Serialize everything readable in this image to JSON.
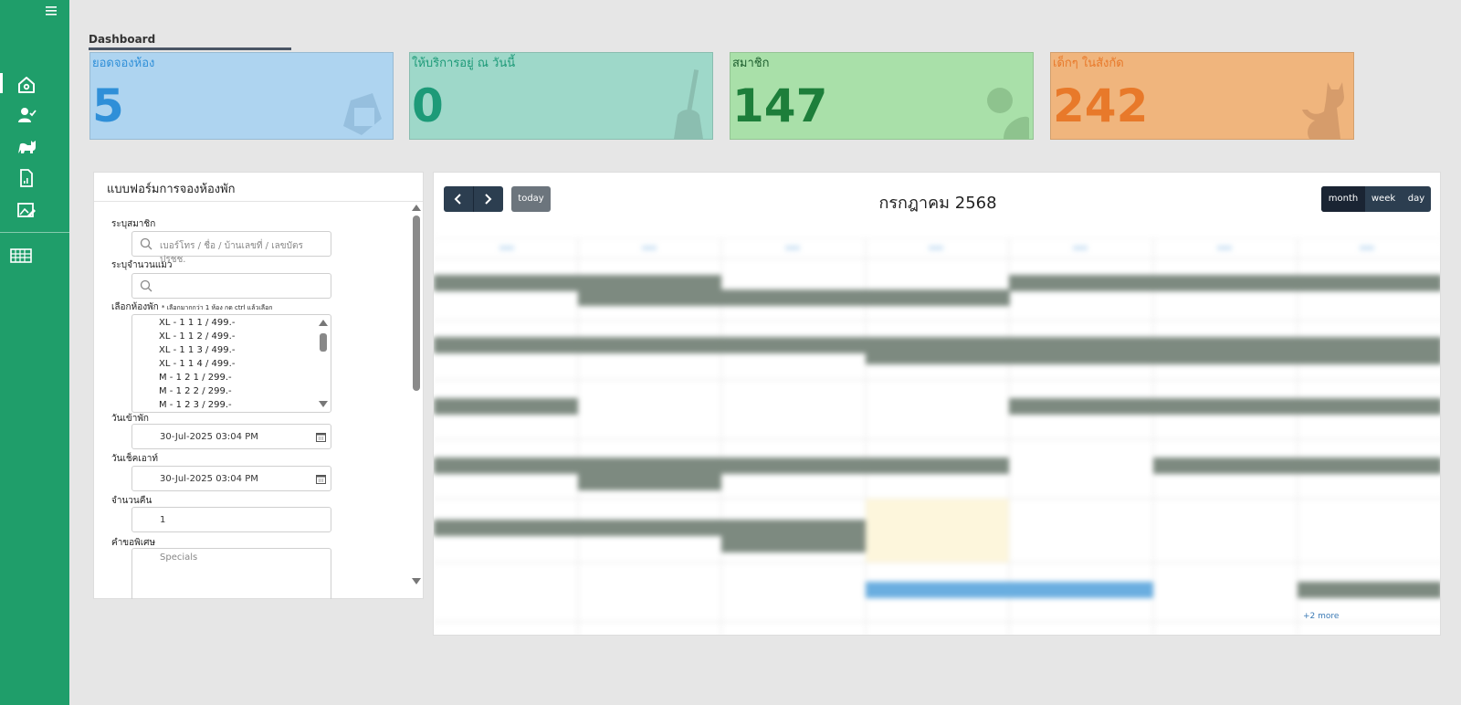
{
  "sidebar": {
    "menu_icon": "hamburger-icon",
    "items": [
      "home-icon",
      "member-check-icon",
      "cat-icon",
      "report-icon",
      "gallery-edit-icon",
      "table-icon"
    ]
  },
  "tab": {
    "label": "Dashboard"
  },
  "cards": [
    {
      "title": "ยอดจองห้อง",
      "value": "5",
      "bg": "#aed4f0",
      "color": "#2f8fd8",
      "icon": "booking-icon"
    },
    {
      "title": "ให้บริการอยู่ ณ วันนี้",
      "value": "0",
      "bg": "#9ed8c9",
      "color": "#1d9a78",
      "icon": "broom-icon"
    },
    {
      "title": "สมาชิก",
      "value": "147",
      "bg": "#a9e0a9",
      "color": "#1d7e3a",
      "icon": "member-icon"
    },
    {
      "title": "เด็กๆ ในสังกัด",
      "value": "242",
      "bg": "#f0b57d",
      "color": "#e8792a",
      "icon": "cat-icon"
    }
  ],
  "form": {
    "title": "แบบฟอร์มการจองห้องพัก",
    "member_label": "ระบุสมาชิก",
    "member_placeholder": "เบอร์โทร / ชื่อ / บ้านเลขที่ / เลขบัตร ปรชช.",
    "cat_count_label": "ระบุจำนวนแมว",
    "cat_count_value": "",
    "room_label": "เลือกห้องพัก",
    "room_hint": "* เลือกมากกว่า 1 ห้อง กด ctrl แล้วเลือก",
    "rooms": [
      "XL - 1 1 1 / 499.-",
      "XL - 1 1 2 / 499.-",
      "XL - 1 1 3 / 499.-",
      "XL - 1 1 4 / 499.-",
      "M - 1 2 1 / 299.-",
      "M - 1 2 2 / 299.-",
      "M - 1 2 3 / 299.-"
    ],
    "checkin_label": "วันเข้าพัก",
    "checkin_value": "30-Jul-2025 03:04 PM",
    "checkout_label": "วันเช็คเอาท์",
    "checkout_value": "30-Jul-2025 03:04 PM",
    "nights_label": "จำนวนคืน",
    "nights_value": "1",
    "special_label": "คำขอพิเศษ",
    "special_placeholder": "Specials"
  },
  "calendar": {
    "prev_icon": "chevron-left-icon",
    "next_icon": "chevron-right-icon",
    "today_label": "today",
    "title": "กรกฎาคม 2568",
    "views": [
      "month",
      "week",
      "day"
    ],
    "active_view": "month",
    "more_link": "+2 more",
    "colors": {
      "event": "#7d8a80",
      "today": "#fdf6dc",
      "highlight": "#6aaee0"
    }
  }
}
